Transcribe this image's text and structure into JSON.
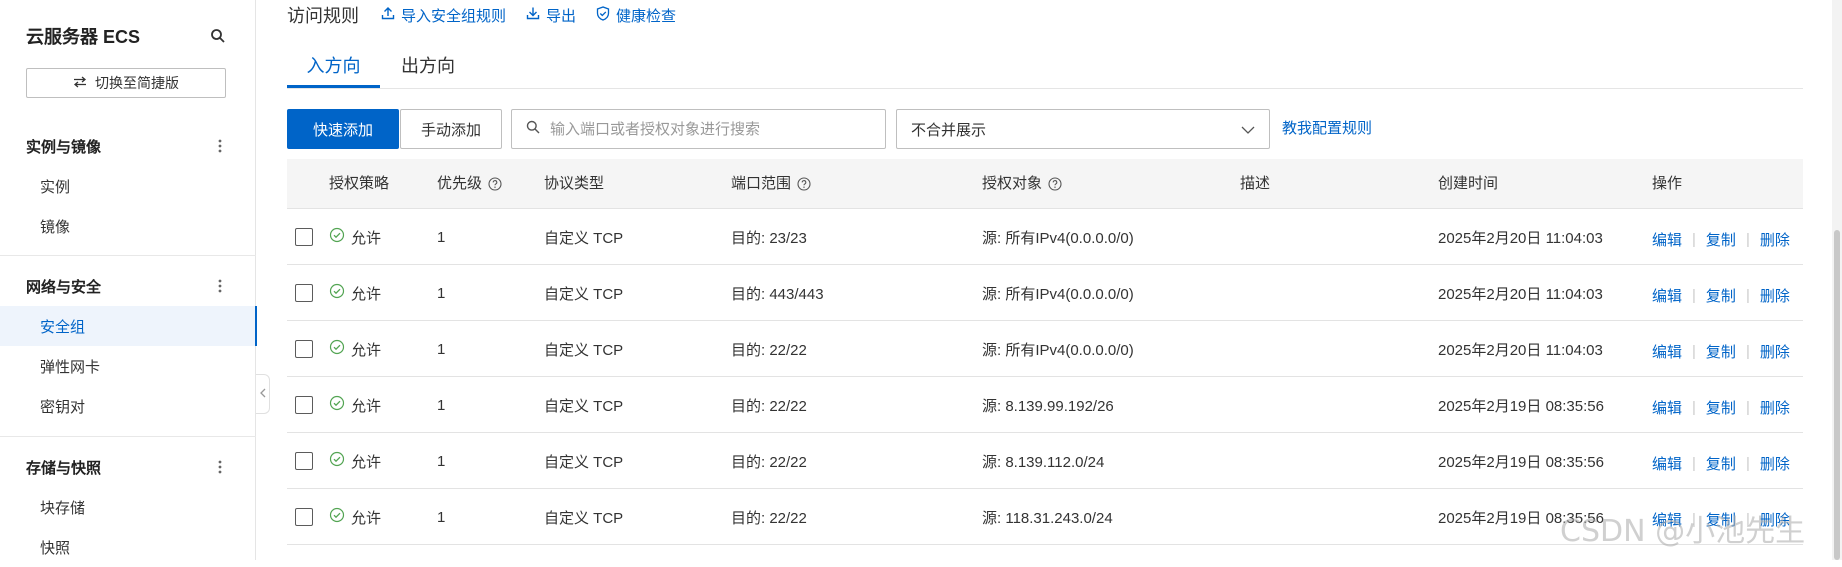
{
  "sidebar": {
    "title": "云服务器 ECS",
    "switch_label": "切换至简捷版",
    "groups": [
      {
        "title": "实例与镜像",
        "items": [
          {
            "label": "实例"
          },
          {
            "label": "镜像"
          }
        ]
      },
      {
        "title": "网络与安全",
        "items": [
          {
            "label": "安全组"
          },
          {
            "label": "弹性网卡"
          },
          {
            "label": "密钥对"
          }
        ]
      },
      {
        "title": "存储与快照",
        "items": [
          {
            "label": "块存储"
          },
          {
            "label": "快照"
          }
        ]
      }
    ],
    "active_item": "安全组"
  },
  "topbar": {
    "title": "访问规则",
    "links": [
      {
        "label": "导入安全组规则"
      },
      {
        "label": "导出"
      },
      {
        "label": "健康检查"
      }
    ]
  },
  "tabs": [
    {
      "label": "入方向",
      "active": true
    },
    {
      "label": "出方向",
      "active": false
    }
  ],
  "toolbar": {
    "quick_add": "快速添加",
    "manual_add": "手动添加",
    "search_placeholder": "输入端口或者授权对象进行搜索",
    "select_value": "不合并展示",
    "help_link": "教我配置规则"
  },
  "table": {
    "columns": {
      "policy": "授权策略",
      "priority": "优先级",
      "protocol": "协议类型",
      "port": "端口范围",
      "target": "授权对象",
      "desc": "描述",
      "created": "创建时间",
      "ops": "操作"
    },
    "actions": {
      "edit": "编辑",
      "copy": "复制",
      "delete": "删除"
    },
    "rows": [
      {
        "policy": "允许",
        "priority": "1",
        "protocol": "自定义 TCP",
        "port": "目的: 23/23",
        "target": "源: 所有IPv4(0.0.0.0/0)",
        "desc": "",
        "created": "2025年2月20日 11:04:03"
      },
      {
        "policy": "允许",
        "priority": "1",
        "protocol": "自定义 TCP",
        "port": "目的: 443/443",
        "target": "源: 所有IPv4(0.0.0.0/0)",
        "desc": "",
        "created": "2025年2月20日 11:04:03"
      },
      {
        "policy": "允许",
        "priority": "1",
        "protocol": "自定义 TCP",
        "port": "目的: 22/22",
        "target": "源: 所有IPv4(0.0.0.0/0)",
        "desc": "",
        "created": "2025年2月20日 11:04:03"
      },
      {
        "policy": "允许",
        "priority": "1",
        "protocol": "自定义 TCP",
        "port": "目的: 22/22",
        "target": "源: 8.139.99.192/26",
        "desc": "",
        "created": "2025年2月19日 08:35:56"
      },
      {
        "policy": "允许",
        "priority": "1",
        "protocol": "自定义 TCP",
        "port": "目的: 22/22",
        "target": "源: 8.139.112.0/24",
        "desc": "",
        "created": "2025年2月19日 08:35:56"
      },
      {
        "policy": "允许",
        "priority": "1",
        "protocol": "自定义 TCP",
        "port": "目的: 22/22",
        "target": "源: 118.31.243.0/24",
        "desc": "",
        "created": "2025年2月19日 08:35:56"
      }
    ]
  },
  "watermark": "CSDN @小池先生",
  "colors": {
    "accent": "#0064c8",
    "allow_green": "#52a452",
    "header_bg": "#f5f5f5"
  }
}
